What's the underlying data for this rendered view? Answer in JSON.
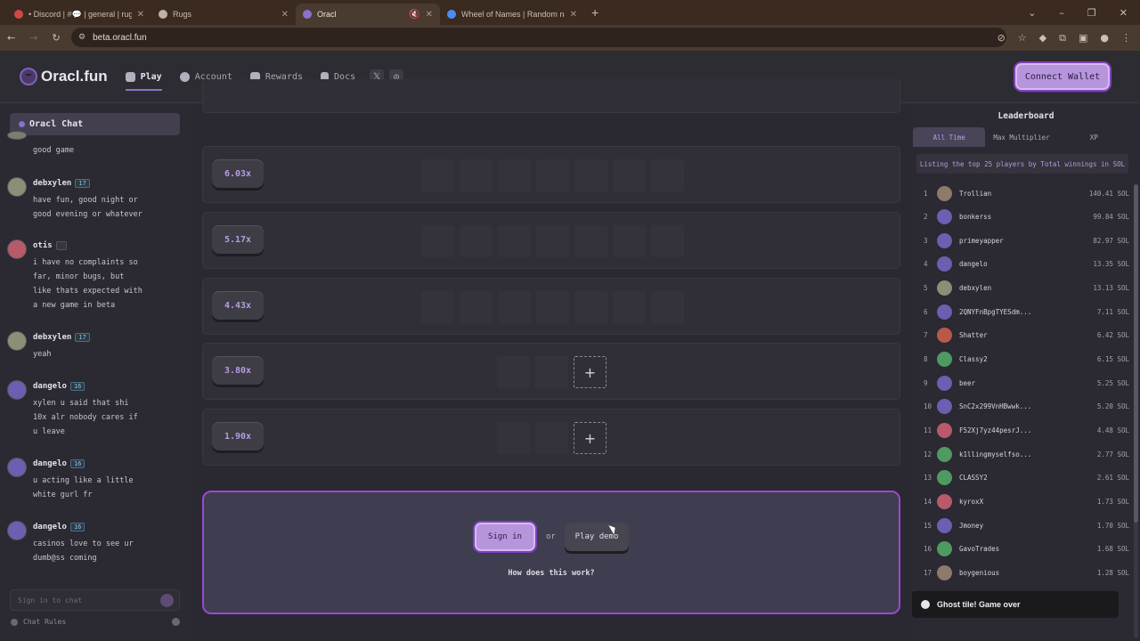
{
  "browser": {
    "tabs": [
      {
        "title": "• Discord | #💬 | general | rugs.",
        "icon_color": "#d04848"
      },
      {
        "title": "Rugs",
        "icon_color": "#c0b2a4"
      },
      {
        "title": "Oracl",
        "icon_color": "#8a72c8"
      },
      {
        "title": "Wheel of Names | Random nam",
        "icon_color": "#4a8cf0"
      }
    ],
    "url": "beta.oracl.fun"
  },
  "app": {
    "logo_text": "Oracl.fun",
    "nav": [
      "Play",
      "Account",
      "Rewards",
      "Docs"
    ],
    "connect_label": "Connect Wallet"
  },
  "chat": {
    "title": "Oracl Chat",
    "messages": [
      {
        "name": "",
        "level": "",
        "text": "good game"
      },
      {
        "name": "debxylen",
        "level": "17",
        "text": "have fun, good night or\ngood evening or whatever"
      },
      {
        "name": "otis",
        "level": "",
        "text": "i have no complaints so\nfar, minor bugs, but\nlike thats expected with\na new game in beta"
      },
      {
        "name": "debxylen",
        "level": "17",
        "text": "yeah"
      },
      {
        "name": "dangelo",
        "level": "16",
        "text": "xylen u said that shi\n10x alr nobody cares if\nu leave"
      },
      {
        "name": "dangelo",
        "level": "16",
        "text": "u acting like a little\nwhite gurl fr"
      },
      {
        "name": "dangelo",
        "level": "16",
        "text": "casinos love to see ur\ndumb@ss coming"
      }
    ],
    "input_placeholder": "Sign in to chat",
    "rules_label": "Chat Rules"
  },
  "game": {
    "rows": [
      {
        "mult": "6.03x"
      },
      {
        "mult": "5.17x"
      },
      {
        "mult": "4.43x"
      },
      {
        "mult": "3.80x"
      },
      {
        "mult": "1.90x"
      }
    ],
    "sign_in": "Sign in",
    "or": "or",
    "play_demo": "Play demo",
    "how": "How does this work?"
  },
  "leaderboard": {
    "title": "Leaderboard",
    "tabs": [
      "All Time",
      "Max Multiplier",
      "XP"
    ],
    "info": "Listing the top 25 players by Total winnings in SOL",
    "rows": [
      {
        "rank": "1",
        "name": "Trollian",
        "amount": "140.41 SOL",
        "color": "#8d7a6a"
      },
      {
        "rank": "2",
        "name": "bonkerss",
        "amount": "99.84 SOL",
        "color": "#6a5fb0"
      },
      {
        "rank": "3",
        "name": "primeyapper",
        "amount": "82.97 SOL",
        "color": "#6a5fb0"
      },
      {
        "rank": "4",
        "name": "dangelo",
        "amount": "13.35 SOL",
        "color": "#6a5fb0"
      },
      {
        "rank": "5",
        "name": "debxylen",
        "amount": "13.13 SOL",
        "color": "#8a8f78"
      },
      {
        "rank": "6",
        "name": "2QNYFnBpgTYESdm...",
        "amount": "7.11 SOL",
        "color": "#6a5fb0"
      },
      {
        "rank": "7",
        "name": "Shatter",
        "amount": "6.42 SOL",
        "color": "#b85a4a"
      },
      {
        "rank": "8",
        "name": "Classy2",
        "amount": "6.15 SOL",
        "color": "#4e9a60"
      },
      {
        "rank": "9",
        "name": "beer",
        "amount": "5.25 SOL",
        "color": "#6a5fb0"
      },
      {
        "rank": "10",
        "name": "SnC2x299VnHBwwk...",
        "amount": "5.20 SOL",
        "color": "#6a5fb0"
      },
      {
        "rank": "11",
        "name": "F52Xj7yz44pesrJ...",
        "amount": "4.48 SOL",
        "color": "#b85a6a"
      },
      {
        "rank": "12",
        "name": "k1llingmyselfso...",
        "amount": "2.77 SOL",
        "color": "#4e9a60"
      },
      {
        "rank": "13",
        "name": "CLASSY2",
        "amount": "2.61 SOL",
        "color": "#4e9a60"
      },
      {
        "rank": "14",
        "name": "kyroxX",
        "amount": "1.73 SOL",
        "color": "#b85a6a"
      },
      {
        "rank": "15",
        "name": "Jmoney",
        "amount": "1.70 SOL",
        "color": "#6a5fb0"
      },
      {
        "rank": "16",
        "name": "GavoTrades",
        "amount": "1.68 SOL",
        "color": "#4e9a60"
      },
      {
        "rank": "17",
        "name": "boygenious",
        "amount": "1.28 SOL",
        "color": "#8d7a6a"
      }
    ]
  },
  "toast": {
    "text": "Ghost tile! Game over"
  }
}
